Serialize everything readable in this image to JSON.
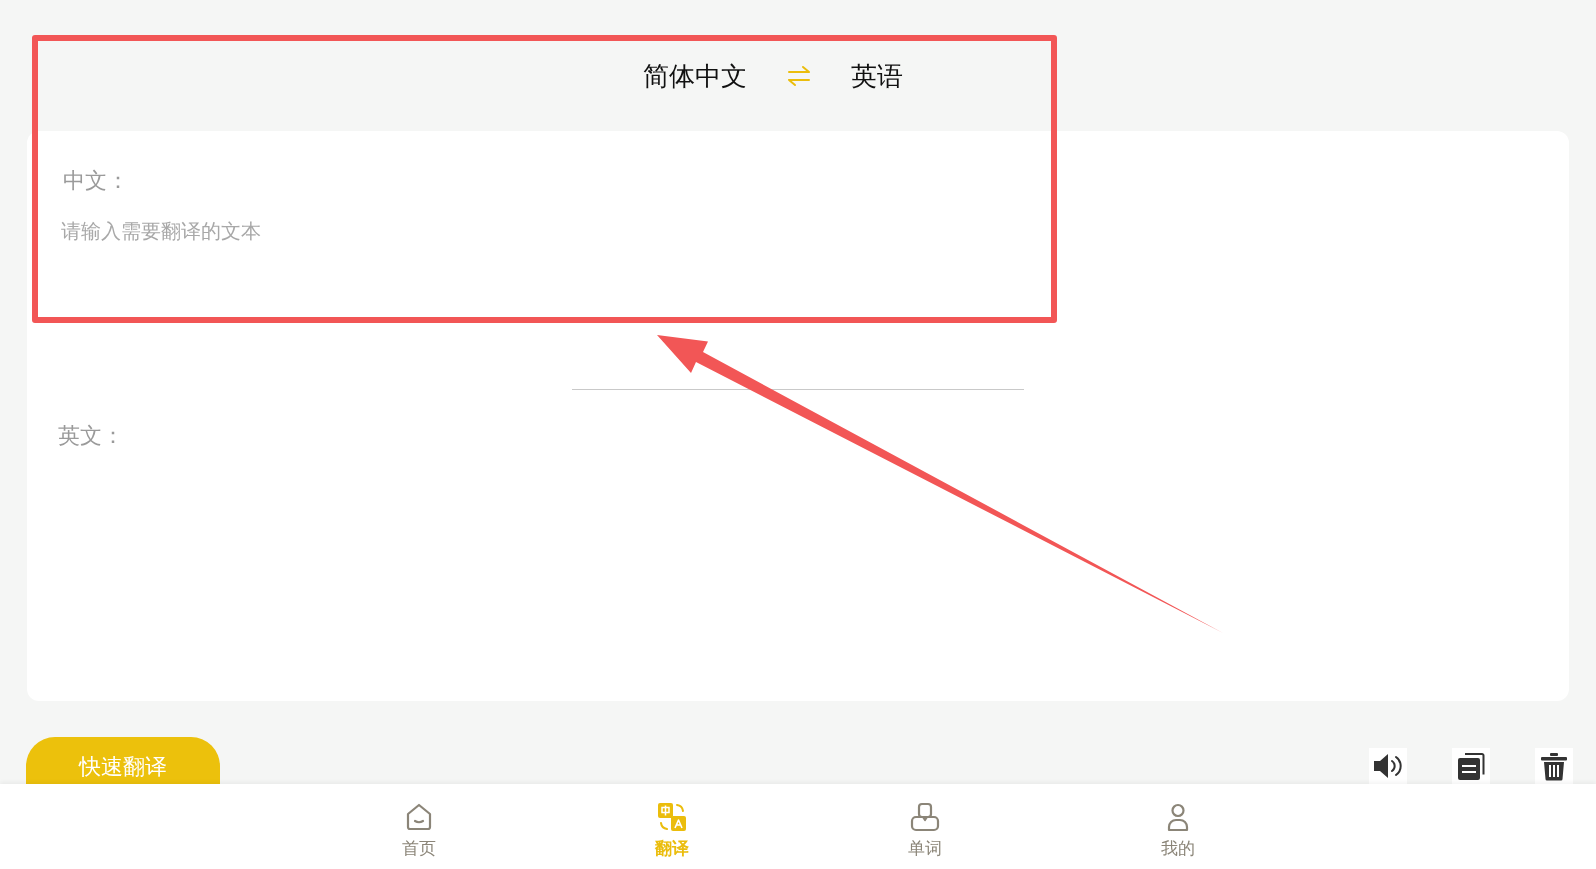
{
  "language_bar": {
    "source_language": "简体中文",
    "target_language": "英语"
  },
  "source_panel": {
    "label": "中文：",
    "placeholder": "请输入需要翻译的文本"
  },
  "result_panel": {
    "label": "英文："
  },
  "translate_button": {
    "label": "快速翻译"
  },
  "tab_bar": [
    {
      "label": "首页",
      "selected": false
    },
    {
      "label": "翻译",
      "selected": true
    },
    {
      "label": "单词",
      "selected": false
    },
    {
      "label": "我的",
      "selected": false
    }
  ],
  "annotations": {
    "highlight_rectangle": true,
    "pointer_arrow": true
  }
}
